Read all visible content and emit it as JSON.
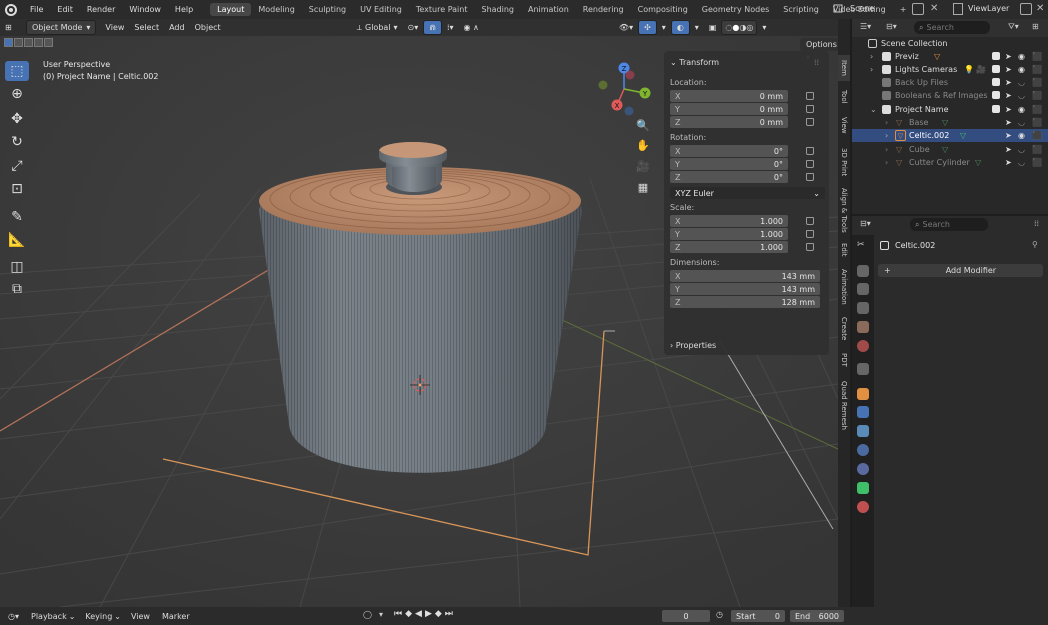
{
  "topbar": {
    "menus": [
      "File",
      "Edit",
      "Render",
      "Window",
      "Help"
    ],
    "workspaces": [
      "Layout",
      "Modeling",
      "Sculpting",
      "UV Editing",
      "Texture Paint",
      "Shading",
      "Animation",
      "Rendering",
      "Compositing",
      "Geometry Nodes",
      "Scripting",
      "Video Editing"
    ],
    "active_workspace": "Layout",
    "add_tab": "+",
    "scene_label": "Scene",
    "viewlayer_label": "ViewLayer"
  },
  "viewport": {
    "mode": "Object Mode",
    "menus": [
      "View",
      "Select",
      "Add",
      "Object"
    ],
    "orientation": "Global",
    "options_label": "Options",
    "perspective": "User Perspective",
    "object_info": "(0) Project Name | Celtic.002",
    "gizmo": {
      "x": "X",
      "y": "Y",
      "z": "Z"
    }
  },
  "npanel": {
    "transform_label": "Transform",
    "location_label": "Location:",
    "location": [
      {
        "axis": "X",
        "value": "0 mm"
      },
      {
        "axis": "Y",
        "value": "0 mm"
      },
      {
        "axis": "Z",
        "value": "0 mm"
      }
    ],
    "rotation_label": "Rotation:",
    "rotation": [
      {
        "axis": "X",
        "value": "0°"
      },
      {
        "axis": "Y",
        "value": "0°"
      },
      {
        "axis": "Z",
        "value": "0°"
      }
    ],
    "rotation_mode": "XYZ Euler",
    "scale_label": "Scale:",
    "scale": [
      {
        "axis": "X",
        "value": "1.000"
      },
      {
        "axis": "Y",
        "value": "1.000"
      },
      {
        "axis": "Z",
        "value": "1.000"
      }
    ],
    "dimensions_label": "Dimensions:",
    "dimensions": [
      {
        "axis": "X",
        "value": "143 mm"
      },
      {
        "axis": "Y",
        "value": "143 mm"
      },
      {
        "axis": "Z",
        "value": "128 mm"
      }
    ],
    "properties_label": "Properties"
  },
  "vtabs": [
    "Item",
    "Tool",
    "View",
    "3D Print",
    "Align & Tools",
    "Edit",
    "Animation",
    "Create",
    "PDT",
    "Quad Remesh"
  ],
  "outliner": {
    "search_placeholder": "Search",
    "rows": [
      {
        "name": "Scene Collection",
        "dim": false,
        "selected": false
      },
      {
        "name": "Previz",
        "dim": false,
        "selected": false
      },
      {
        "name": "Lights Cameras",
        "dim": false,
        "selected": false
      },
      {
        "name": "Back Up Files",
        "dim": true,
        "selected": false
      },
      {
        "name": "Booleans & Ref Images",
        "dim": true,
        "selected": false
      },
      {
        "name": "Project Name",
        "dim": false,
        "selected": false
      },
      {
        "name": "Base",
        "dim": true,
        "selected": false
      },
      {
        "name": "Celtic.002",
        "dim": false,
        "selected": true
      },
      {
        "name": "Cube",
        "dim": true,
        "selected": false
      },
      {
        "name": "Cutter Cylinder",
        "dim": true,
        "selected": false
      }
    ]
  },
  "properties": {
    "search_placeholder": "Search",
    "object_name": "Celtic.002",
    "add_modifier": "Add Modifier",
    "add_symbol": "+"
  },
  "timeline": {
    "menus": [
      "Playback",
      "Keying",
      "View",
      "Marker"
    ],
    "current_frame": "0",
    "start_label": "Start",
    "start_value": "0",
    "end_label": "End",
    "end_value": "6000"
  },
  "colors": {
    "accent": "#4772b3",
    "selection_outline": "#e08a3a",
    "object_gray": "#6e767e",
    "object_orange": "#c28a68"
  }
}
